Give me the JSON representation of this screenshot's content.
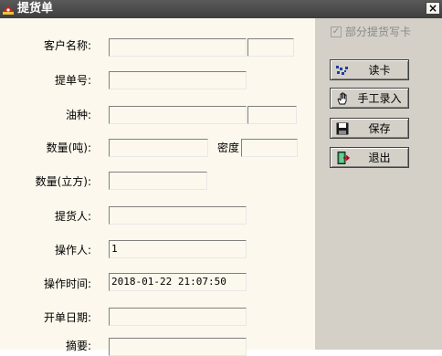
{
  "window": {
    "title": "提货单",
    "close_glyph": "×"
  },
  "form": {
    "customer_label": "客户名称:",
    "bill_no_label": "提单号:",
    "oil_type_label": "油种:",
    "qty_ton_label": "数量(吨):",
    "density_label": "密度",
    "qty_m3_label": "数量(立方):",
    "picker_label": "提货人:",
    "operator_label": "操作人:",
    "operator_value": "1",
    "op_time_label": "操作时间:",
    "op_time_value": "2018-01-22 21:07:50",
    "open_date_label": "开单日期:",
    "summary_label": "摘要:"
  },
  "side": {
    "partial_write_label": "部分提货写卡",
    "partial_write_checked": true,
    "read_card_label": "读卡",
    "manual_entry_label": "手工录入",
    "save_label": "保存",
    "exit_label": "退出"
  },
  "icons": [
    "app-icon",
    "close-icon",
    "read-card-icon",
    "hand-icon",
    "save-icon",
    "exit-door-icon"
  ]
}
